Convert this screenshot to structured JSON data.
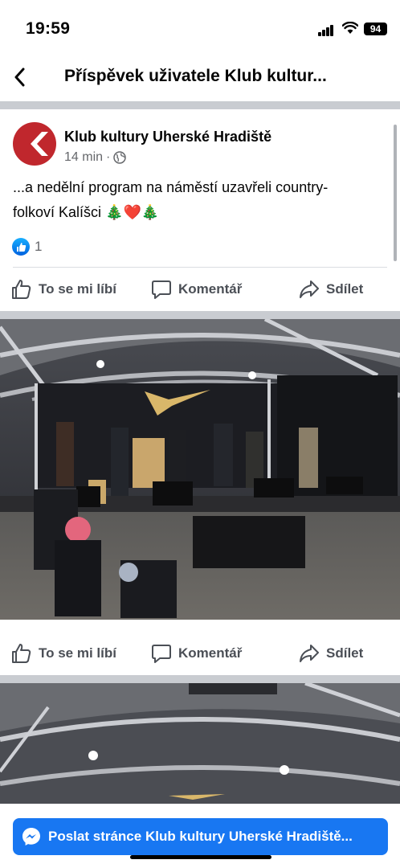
{
  "status_bar": {
    "time": "19:59",
    "battery": "94"
  },
  "nav": {
    "title": "Příspěvek uživatele Klub kultur...",
    "back_icon": "chevron-left-icon"
  },
  "post": {
    "author": "Klub kultury Uherské Hradiště",
    "time": "14 min",
    "separator": "·",
    "audience_icon": "globe-icon",
    "text_line1": "...a nedělní program na náměstí uzavřeli country-",
    "text_line2": "folkoví Kalíšci",
    "emojis": [
      "🎄",
      "❤️",
      "🎄"
    ],
    "reaction_count": "1"
  },
  "actions": {
    "like": "To se mi líbí",
    "comment": "Komentář",
    "share": "Sdílet"
  },
  "messenger_button": {
    "label": "Poslat stránce Klub kultury Uherské Hradiště..."
  },
  "colors": {
    "brand_blue": "#1877f2",
    "avatar_red": "#c0272d",
    "divider": "#c9ccd1"
  }
}
